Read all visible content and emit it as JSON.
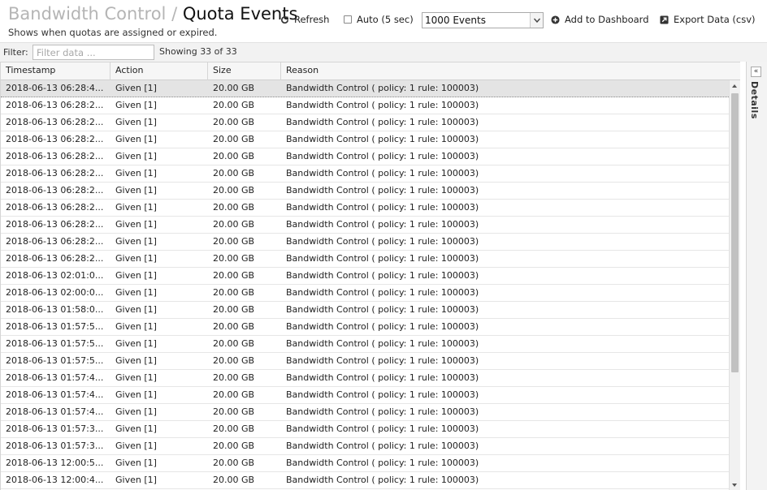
{
  "header": {
    "breadcrumb": "Bandwidth Control",
    "separator": "/",
    "title": "Quota Events",
    "subtitle": "Shows when quotas are assigned or expired."
  },
  "toolbar": {
    "refresh_label": "Refresh",
    "auto_label": "Auto (5 sec)",
    "auto_checked": false,
    "events_selected": "1000 Events",
    "add_dashboard_label": "Add to Dashboard",
    "export_label": "Export Data (csv)"
  },
  "filter": {
    "label": "Filter:",
    "placeholder": "Filter data ...",
    "value": "",
    "showing": "Showing 33 of 33"
  },
  "grid": {
    "columns": [
      "Timestamp",
      "Action",
      "Size",
      "Reason"
    ],
    "rows": [
      [
        "2018-06-13 06:28:4...",
        "Given [1]",
        "20.00 GB",
        "Bandwidth Control ( policy: 1 rule: 100003)"
      ],
      [
        "2018-06-13 06:28:2...",
        "Given [1]",
        "20.00 GB",
        "Bandwidth Control ( policy: 1 rule: 100003)"
      ],
      [
        "2018-06-13 06:28:2...",
        "Given [1]",
        "20.00 GB",
        "Bandwidth Control ( policy: 1 rule: 100003)"
      ],
      [
        "2018-06-13 06:28:2...",
        "Given [1]",
        "20.00 GB",
        "Bandwidth Control ( policy: 1 rule: 100003)"
      ],
      [
        "2018-06-13 06:28:2...",
        "Given [1]",
        "20.00 GB",
        "Bandwidth Control ( policy: 1 rule: 100003)"
      ],
      [
        "2018-06-13 06:28:2...",
        "Given [1]",
        "20.00 GB",
        "Bandwidth Control ( policy: 1 rule: 100003)"
      ],
      [
        "2018-06-13 06:28:2...",
        "Given [1]",
        "20.00 GB",
        "Bandwidth Control ( policy: 1 rule: 100003)"
      ],
      [
        "2018-06-13 06:28:2...",
        "Given [1]",
        "20.00 GB",
        "Bandwidth Control ( policy: 1 rule: 100003)"
      ],
      [
        "2018-06-13 06:28:2...",
        "Given [1]",
        "20.00 GB",
        "Bandwidth Control ( policy: 1 rule: 100003)"
      ],
      [
        "2018-06-13 06:28:2...",
        "Given [1]",
        "20.00 GB",
        "Bandwidth Control ( policy: 1 rule: 100003)"
      ],
      [
        "2018-06-13 06:28:2...",
        "Given [1]",
        "20.00 GB",
        "Bandwidth Control ( policy: 1 rule: 100003)"
      ],
      [
        "2018-06-13 02:01:0...",
        "Given [1]",
        "20.00 GB",
        "Bandwidth Control ( policy: 1 rule: 100003)"
      ],
      [
        "2018-06-13 02:00:0...",
        "Given [1]",
        "20.00 GB",
        "Bandwidth Control ( policy: 1 rule: 100003)"
      ],
      [
        "2018-06-13 01:58:0...",
        "Given [1]",
        "20.00 GB",
        "Bandwidth Control ( policy: 1 rule: 100003)"
      ],
      [
        "2018-06-13 01:57:5...",
        "Given [1]",
        "20.00 GB",
        "Bandwidth Control ( policy: 1 rule: 100003)"
      ],
      [
        "2018-06-13 01:57:5...",
        "Given [1]",
        "20.00 GB",
        "Bandwidth Control ( policy: 1 rule: 100003)"
      ],
      [
        "2018-06-13 01:57:5...",
        "Given [1]",
        "20.00 GB",
        "Bandwidth Control ( policy: 1 rule: 100003)"
      ],
      [
        "2018-06-13 01:57:4...",
        "Given [1]",
        "20.00 GB",
        "Bandwidth Control ( policy: 1 rule: 100003)"
      ],
      [
        "2018-06-13 01:57:4...",
        "Given [1]",
        "20.00 GB",
        "Bandwidth Control ( policy: 1 rule: 100003)"
      ],
      [
        "2018-06-13 01:57:4...",
        "Given [1]",
        "20.00 GB",
        "Bandwidth Control ( policy: 1 rule: 100003)"
      ],
      [
        "2018-06-13 01:57:3...",
        "Given [1]",
        "20.00 GB",
        "Bandwidth Control ( policy: 1 rule: 100003)"
      ],
      [
        "2018-06-13 01:57:3...",
        "Given [1]",
        "20.00 GB",
        "Bandwidth Control ( policy: 1 rule: 100003)"
      ],
      [
        "2018-06-13 12:00:5...",
        "Given [1]",
        "20.00 GB",
        "Bandwidth Control ( policy: 1 rule: 100003)"
      ],
      [
        "2018-06-13 12:00:4...",
        "Given [1]",
        "20.00 GB",
        "Bandwidth Control ( policy: 1 rule: 100003)"
      ]
    ],
    "selected_row": 0
  },
  "details": {
    "label": "Details",
    "toggle_glyph": "«"
  },
  "icons": {
    "refresh": "refresh-icon",
    "add": "plus-circle-icon",
    "export": "export-icon",
    "dropdown": "chevron-down-icon"
  }
}
